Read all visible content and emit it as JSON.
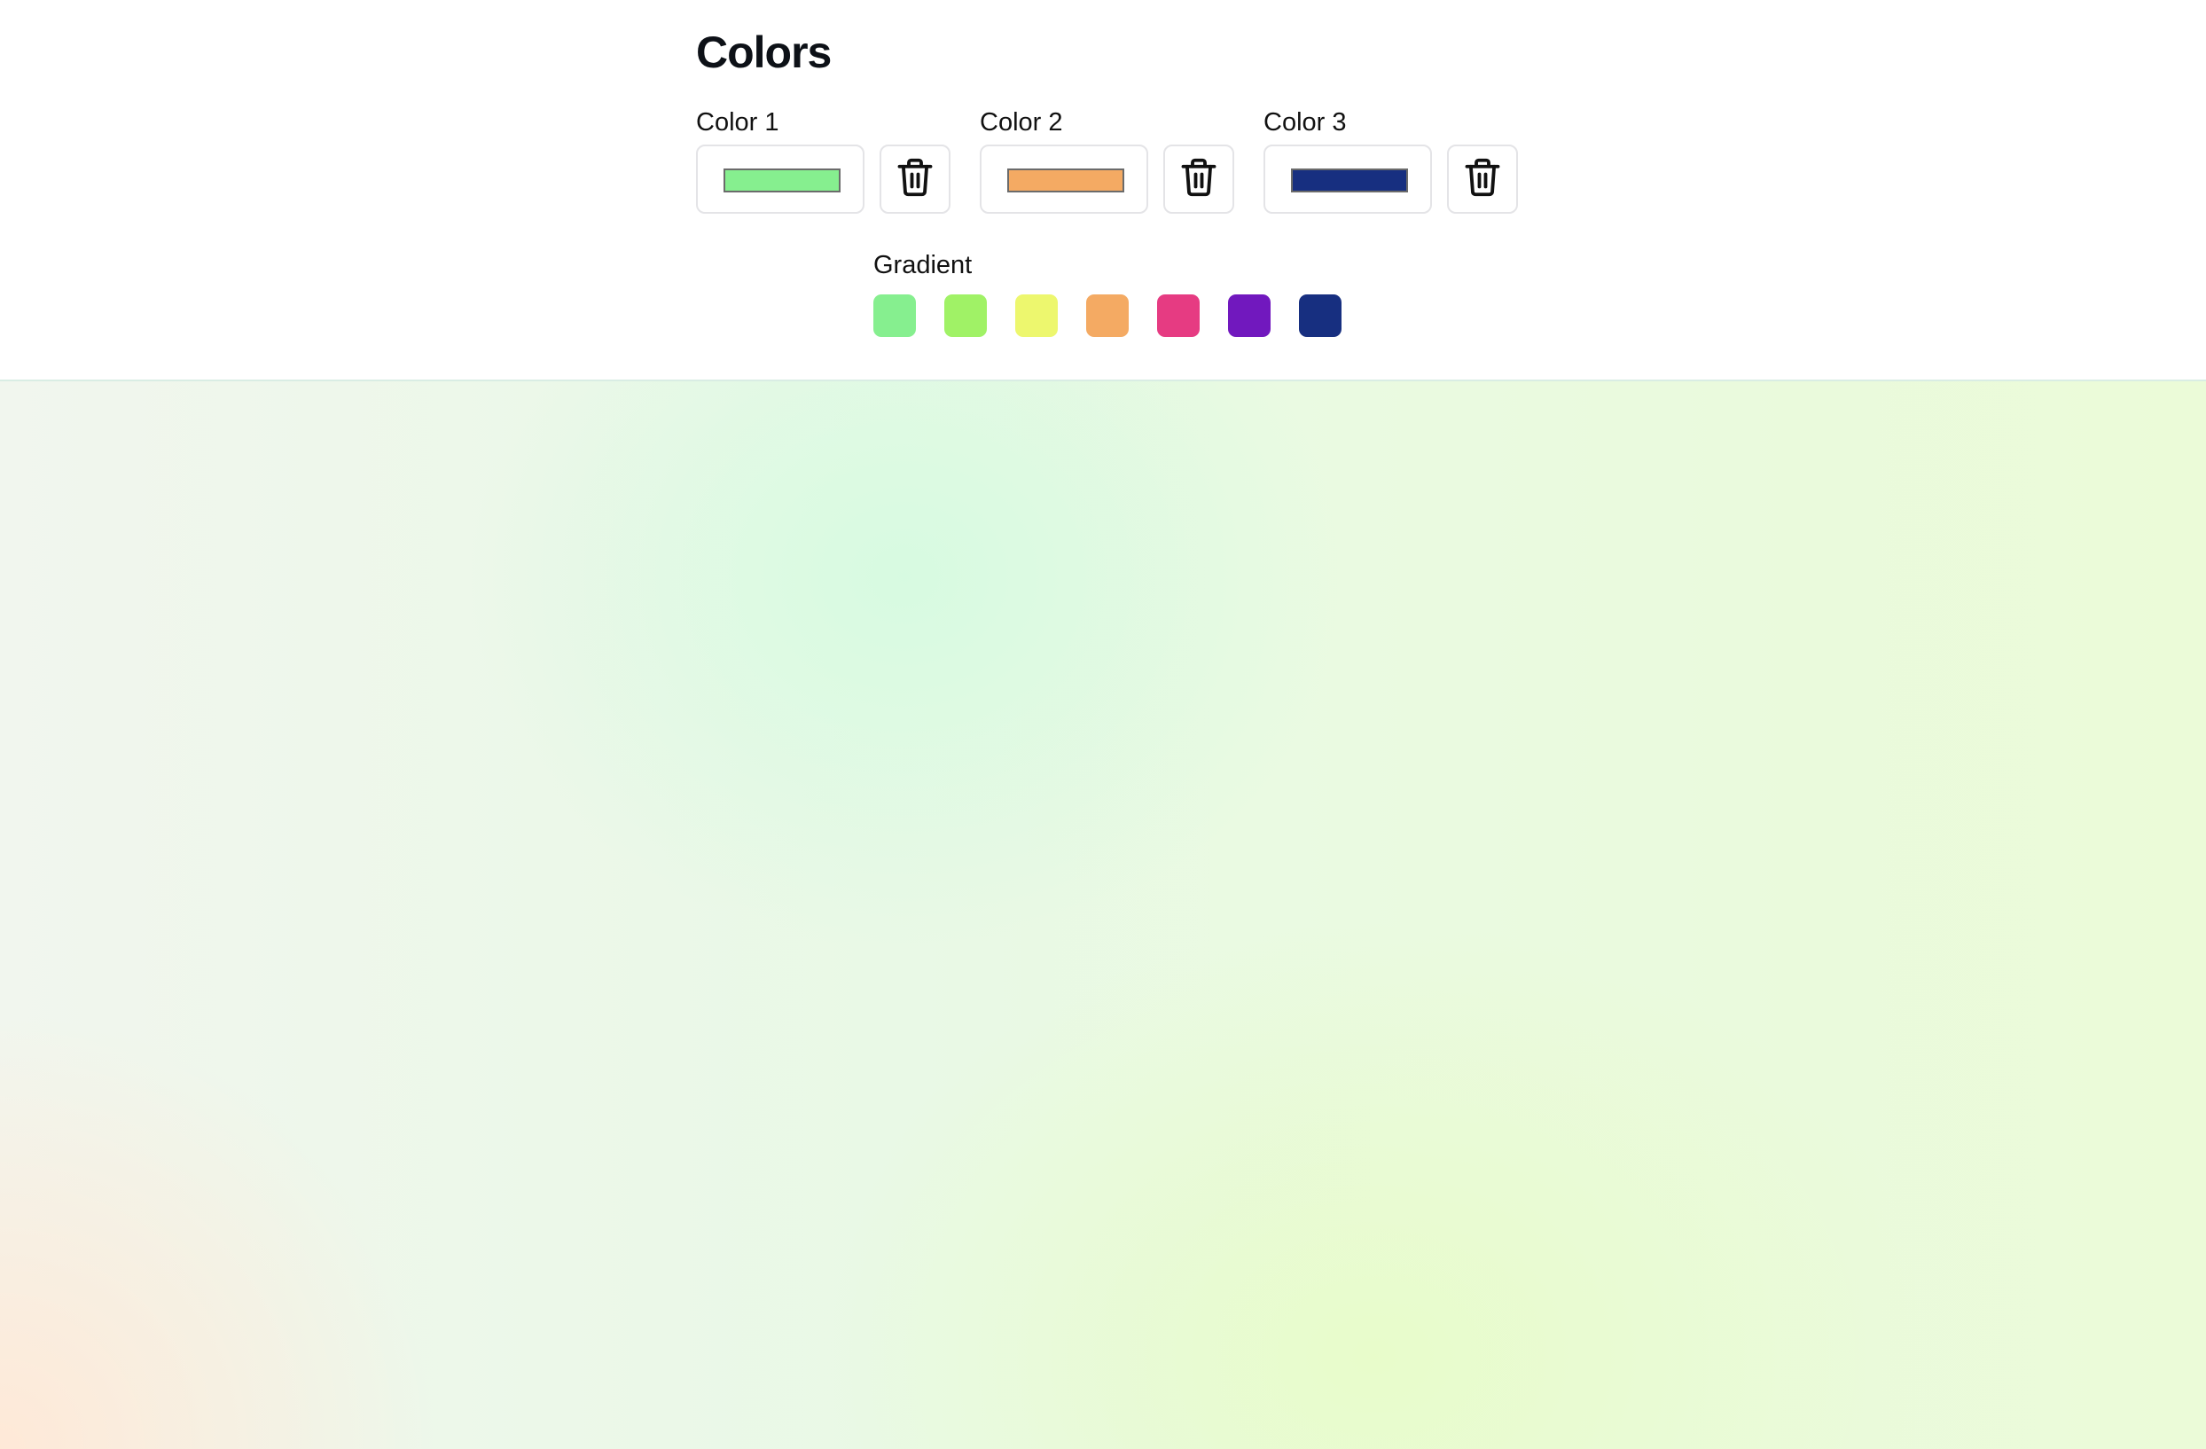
{
  "title": "Colors",
  "colors": [
    {
      "label": "Color 1",
      "value": "#86ef8f",
      "delete_icon": "trash-icon"
    },
    {
      "label": "Color 2",
      "value": "#f4aa63",
      "delete_icon": "trash-icon"
    },
    {
      "label": "Color 3",
      "value": "#172f80",
      "delete_icon": "trash-icon"
    }
  ],
  "gradient": {
    "label": "Gradient",
    "swatches": [
      "#86ef8f",
      "#a0f266",
      "#edf76e",
      "#f4aa63",
      "#e63b82",
      "#7118be",
      "#172f80"
    ]
  }
}
